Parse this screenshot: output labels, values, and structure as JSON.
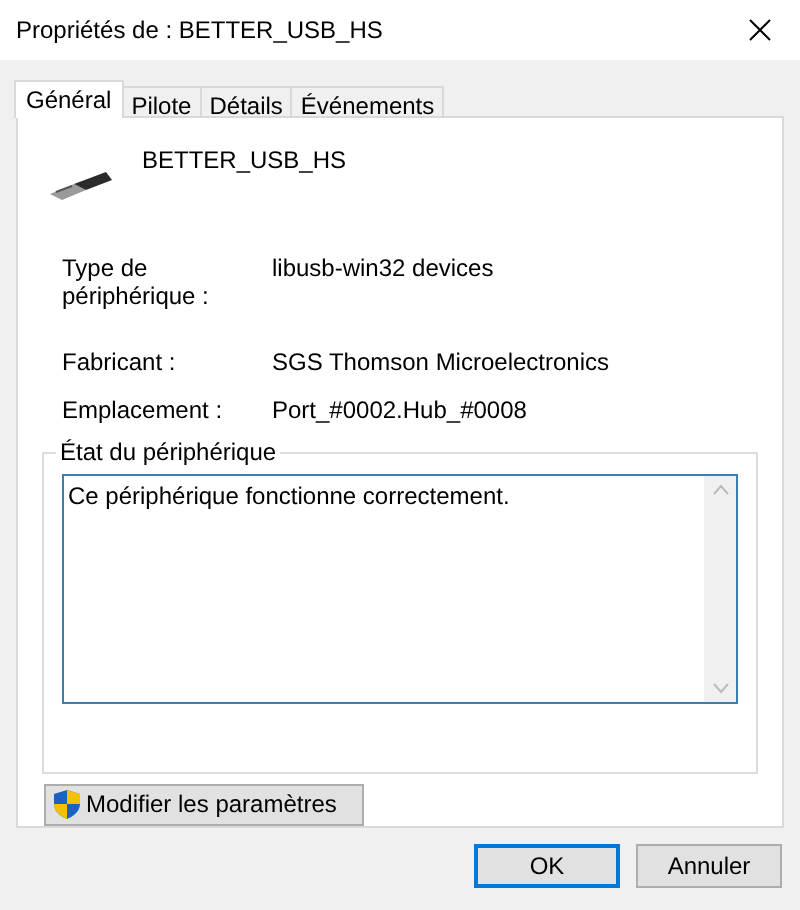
{
  "window": {
    "title": "Propriétés de : BETTER_USB_HS"
  },
  "tabs": [
    {
      "label": "Général",
      "selected": true
    },
    {
      "label": "Pilote",
      "selected": false
    },
    {
      "label": "Détails",
      "selected": false
    },
    {
      "label": "Événements",
      "selected": false
    }
  ],
  "device": {
    "name": "BETTER_USB_HS"
  },
  "properties": [
    {
      "label": "Type de périphérique :",
      "value": "libusb-win32 devices"
    },
    {
      "label": "Fabricant :",
      "value": "SGS Thomson Microelectronics"
    },
    {
      "label": "Emplacement :",
      "value": "Port_#0002.Hub_#0008"
    }
  ],
  "status": {
    "legend": "État du périphérique",
    "text": "Ce périphérique fonctionne correctement."
  },
  "change_button": "Modifier les paramètres",
  "buttons": [
    {
      "label": "OK",
      "default": true
    },
    {
      "label": "Annuler",
      "default": false
    }
  ]
}
